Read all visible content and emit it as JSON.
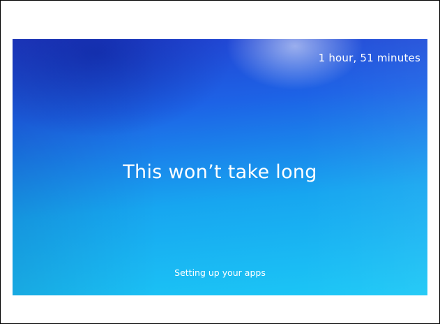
{
  "setup_screen": {
    "time_remaining": "1 hour, 51 minutes",
    "headline": "This won’t take long",
    "status": "Setting up your apps"
  },
  "colors": {
    "background_top": "#2340d0",
    "background_bottom": "#1cc8f6",
    "text": "#ffffff",
    "frame_border": "#000000"
  }
}
